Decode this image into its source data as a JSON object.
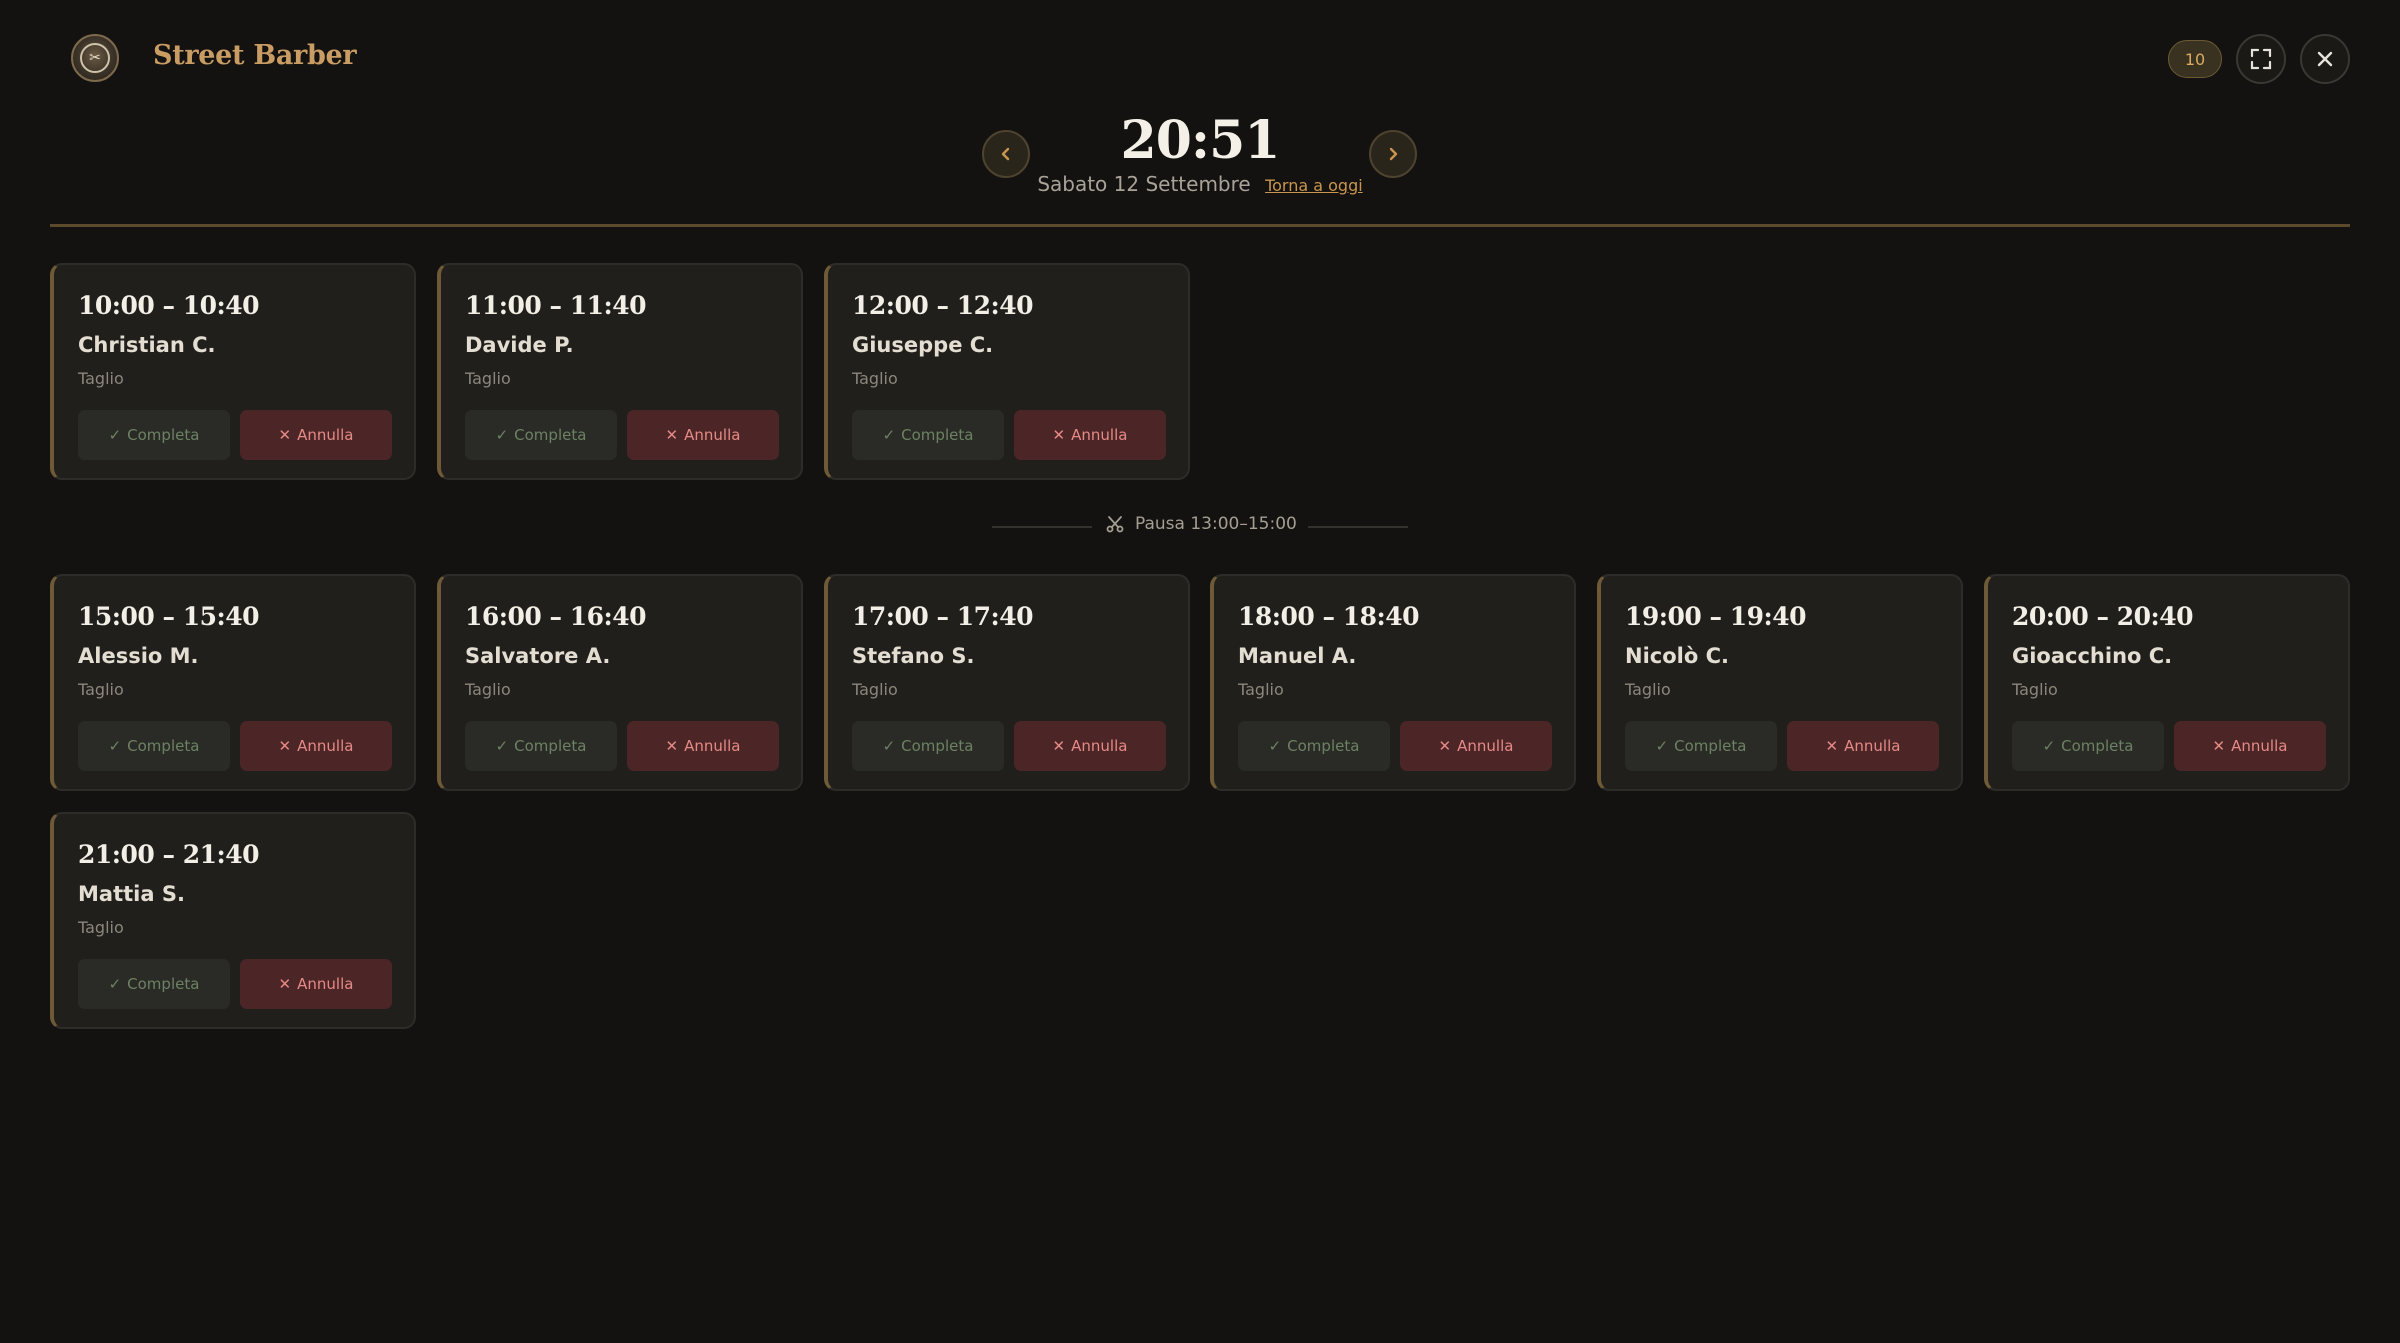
{
  "header": {
    "brand": "Street Barber",
    "logo_icon": "barber-logo",
    "count_badge": "10"
  },
  "clock": {
    "time": "20:51",
    "date": "Sabato 12 Settembre",
    "today_link": "Torna a oggi"
  },
  "pause": {
    "label": "Pausa 13:00–15:00",
    "icon": "scissors-icon"
  },
  "actions": {
    "complete_label": "Completa",
    "cancel_label": "Annulla"
  },
  "appointments": [
    {
      "time": "10:00 – 10:40",
      "client": "Christian C.",
      "service": "Taglio"
    },
    {
      "time": "11:00 – 11:40",
      "client": "Davide P.",
      "service": "Taglio"
    },
    {
      "time": "12:00 – 12:40",
      "client": "Giuseppe C.",
      "service": "Taglio"
    },
    {
      "time": "15:00 – 15:40",
      "client": "Alessio M.",
      "service": "Taglio"
    },
    {
      "time": "16:00 – 16:40",
      "client": "Salvatore A.",
      "service": "Taglio"
    },
    {
      "time": "17:00 – 17:40",
      "client": "Stefano S.",
      "service": "Taglio"
    },
    {
      "time": "18:00 – 18:40",
      "client": "Manuel A.",
      "service": "Taglio"
    },
    {
      "time": "19:00 – 19:40",
      "client": "Nicolò C.",
      "service": "Taglio"
    },
    {
      "time": "20:00 – 20:40",
      "client": "Gioacchino C.",
      "service": "Taglio"
    },
    {
      "time": "21:00 – 21:40",
      "client": "Mattia S.",
      "service": "Taglio"
    }
  ],
  "colors": {
    "background": "#131210",
    "accent_gold": "#c89c63",
    "complete_green": "#6d8263",
    "cancel_red": "#e58a86"
  }
}
